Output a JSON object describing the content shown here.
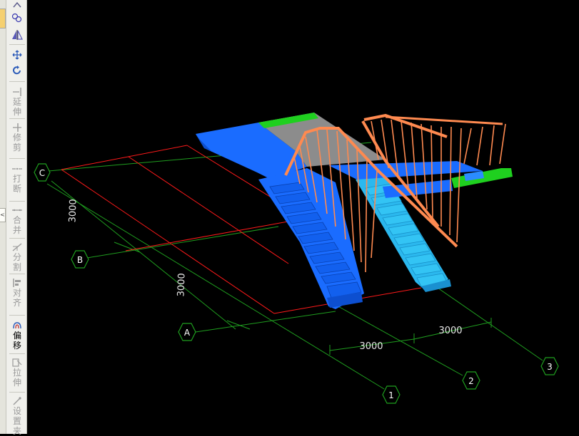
{
  "toolbar": {
    "tools": [
      {
        "name": "extend",
        "label": "延伸",
        "icon": "extend-icon"
      },
      {
        "name": "trim",
        "label": "修剪",
        "icon": "trim-icon"
      },
      {
        "name": "break",
        "label": "打断",
        "icon": "break-icon"
      },
      {
        "name": "merge",
        "label": "合并",
        "icon": "merge-icon"
      },
      {
        "name": "split",
        "label": "分割",
        "icon": "split-icon"
      },
      {
        "name": "align",
        "label": "对齐",
        "icon": "align-icon"
      },
      {
        "name": "offset",
        "label": "偏移",
        "icon": "offset-icon"
      },
      {
        "name": "stretch",
        "label": "拉伸",
        "icon": "stretch-icon"
      },
      {
        "name": "set-support",
        "label": "设置夹",
        "icon": "set-support-icon"
      }
    ],
    "top_icons": [
      "copy-icon",
      "mirror-icon",
      "move-icon",
      "rotate-icon"
    ],
    "edge_tab": "<"
  },
  "viewport": {
    "axis_labels": {
      "C": "C",
      "B": "B",
      "A": "A",
      "n1": "1",
      "n2": "2",
      "n3": "3"
    },
    "dimensions": {
      "cb": "3000",
      "ba": "3000",
      "x12": "3000",
      "x23": "3000"
    },
    "colors": {
      "background": "#000000",
      "axis_line": "#1f9e1f",
      "grid_red": "#ff1a1a",
      "slab_blue": "#1a6cff",
      "stair_light": "#2bb8ee",
      "railing": "#ff8a50",
      "beam_green": "#1fd01f",
      "slab_gray": "#8c8c8c"
    }
  }
}
